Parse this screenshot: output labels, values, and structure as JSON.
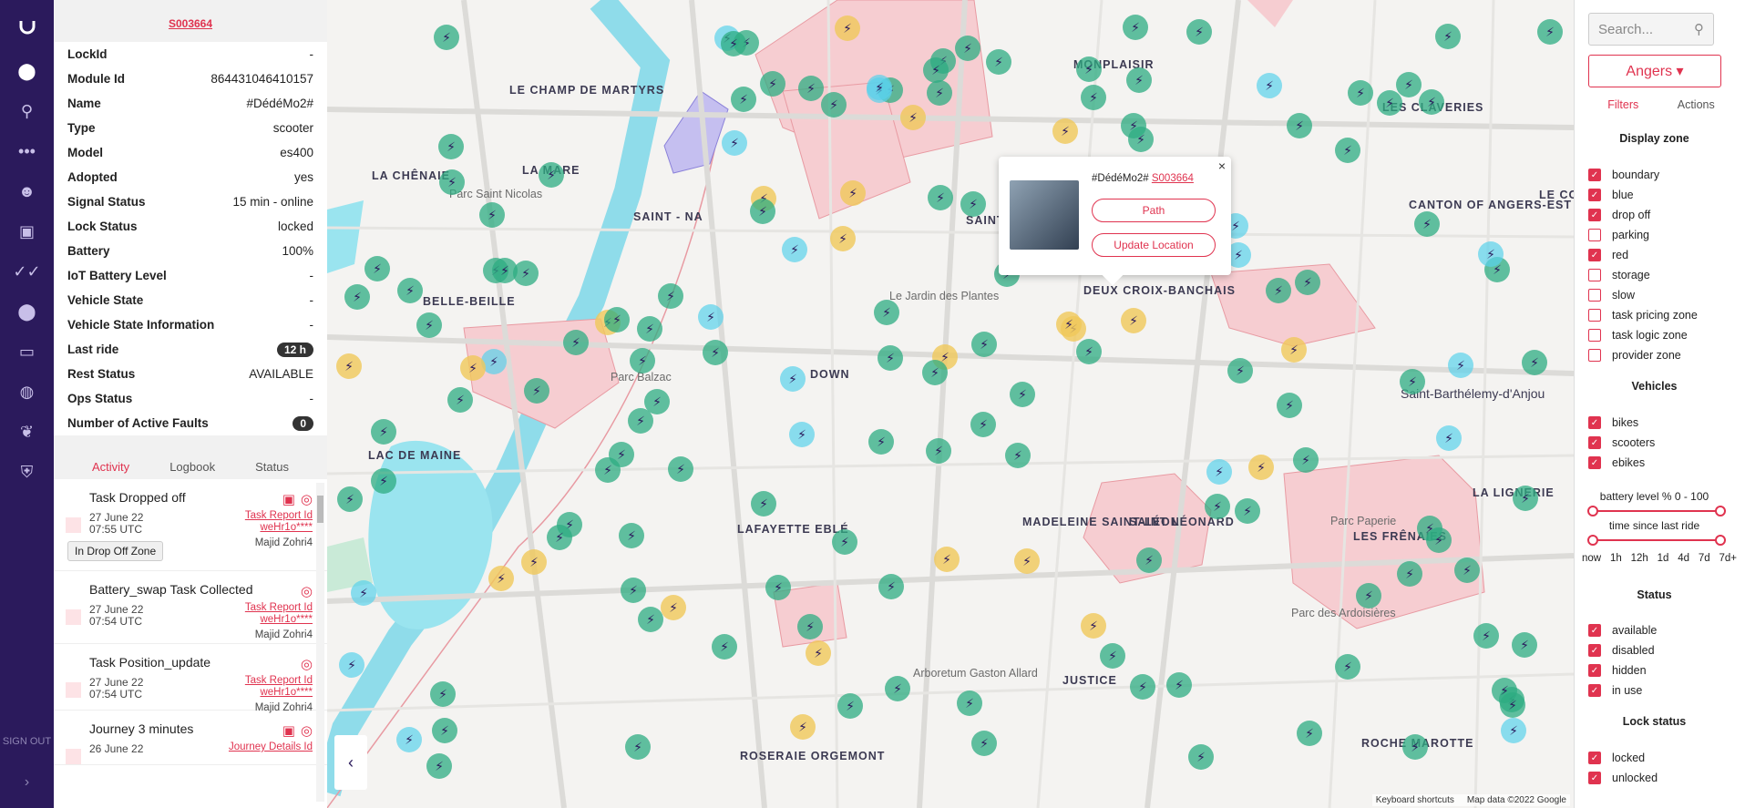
{
  "nav": {
    "signout": "SIGN OUT",
    "items": [
      "map-pin-icon",
      "bike-icon",
      "dots-icon",
      "user-icon",
      "ticket-icon",
      "check-icon",
      "location-icon",
      "card-icon",
      "globe-icon",
      "butterfly-icon",
      "shield-icon"
    ]
  },
  "vehicle": {
    "id_link": "S003664",
    "props": [
      {
        "k": "LockId",
        "v": "-"
      },
      {
        "k": "Module Id",
        "v": "864431046410157"
      },
      {
        "k": "Name",
        "v": "#DédéMo2#"
      },
      {
        "k": "Type",
        "v": "scooter"
      },
      {
        "k": "Model",
        "v": "es400"
      },
      {
        "k": "Adopted",
        "v": "yes"
      },
      {
        "k": "Signal Status",
        "v": "15 min - online"
      },
      {
        "k": "Lock Status",
        "v": "locked"
      },
      {
        "k": "Battery",
        "v": "100%"
      },
      {
        "k": "IoT Battery Level",
        "v": "-"
      },
      {
        "k": "Vehicle State",
        "v": "-"
      },
      {
        "k": "Vehicle State Information",
        "v": "-"
      },
      {
        "k": "Last ride",
        "v": "12 h"
      },
      {
        "k": "Rest Status",
        "v": "AVAILABLE"
      },
      {
        "k": "Ops Status",
        "v": "-"
      },
      {
        "k": "Number of Active Faults",
        "v": "0"
      }
    ]
  },
  "tabs": [
    "Activity",
    "Logbook",
    "Status"
  ],
  "activity": [
    {
      "title": "Task Dropped off",
      "date": "27 June 22",
      "time": "07:55 UTC",
      "link": "Task Report Id",
      "link2": "weHr1o****",
      "who": "Majid Zohri4",
      "tag": "In Drop Off Zone"
    },
    {
      "title": "Battery_swap Task Collected",
      "date": "27 June 22",
      "time": "07:54 UTC",
      "link": "Task Report Id",
      "link2": "weHr1o****",
      "who": "Majid Zohri4"
    },
    {
      "title": "Task Position_update",
      "date": "27 June 22",
      "time": "07:54 UTC",
      "link": "Task Report Id",
      "link2": "weHr1o****",
      "who": "Majid Zohri4"
    },
    {
      "title": "Journey 3 minutes",
      "date": "26 June 22",
      "time": "",
      "link": "Journey Details Id",
      "link2": "",
      "who": ""
    }
  ],
  "popup": {
    "name": "#DédéMo2#",
    "link": "S003664",
    "path_btn": "Path",
    "update_btn": "Update Location",
    "close": "×"
  },
  "map_labels": [
    "LE CHAMP DE MARTYRS",
    "LA MARE",
    "MONPLAISIR",
    "LES CLAVERIES",
    "LA CHÊNAIE",
    "Parc Saint Nicolas",
    "SAINT - NA",
    "SAINT-SERGE",
    "CANTON OF ANGERS-EST",
    "LE CO",
    "BELLE-BEILLE",
    "DEUX CROIX-BANCHAIS",
    "Parc Balzac",
    "LAC DE MAINE",
    "DOWN",
    "Saint-Barthélemy-d'Anjou",
    "LA LIGNERIE",
    "MADELEINE SAINT-LÉON",
    "SAINT LÉONARD",
    "LES FRÊNAIES",
    "Parc Paperie",
    "LAFAYETTE EBLÉ",
    "JUSTICE",
    "Parc des Ardoisières",
    "ROCHE MAROTTE",
    "ROSERAIE ORGEMONT",
    "Arboretum Gaston Allard",
    "Le Jardin des Plantes"
  ],
  "attribution": {
    "shortcuts": "Keyboard shortcuts",
    "data": "Map data ©2022 Google"
  },
  "right": {
    "search_placeholder": "Search...",
    "city": "Angers ▾",
    "tabs": [
      "Filters",
      "Actions"
    ],
    "display_zone_title": "Display zone",
    "zones": [
      {
        "label": "boundary",
        "on": true
      },
      {
        "label": "blue",
        "on": true
      },
      {
        "label": "drop off",
        "on": true
      },
      {
        "label": "parking",
        "on": false
      },
      {
        "label": "red",
        "on": true
      },
      {
        "label": "storage",
        "on": false
      },
      {
        "label": "slow",
        "on": false
      },
      {
        "label": "task pricing zone",
        "on": false
      },
      {
        "label": "task logic zone",
        "on": false
      },
      {
        "label": "provider zone",
        "on": false
      }
    ],
    "vehicles_title": "Vehicles",
    "vehicles": [
      {
        "label": "bikes",
        "on": true
      },
      {
        "label": "scooters",
        "on": true
      },
      {
        "label": "ebikes",
        "on": true
      }
    ],
    "battery_label": "battery level % 0 - 100",
    "ride_label": "time since last ride",
    "ride_ticks": [
      "now",
      "1h",
      "12h",
      "1d",
      "4d",
      "7d",
      "7d+"
    ],
    "status_title": "Status",
    "status": [
      {
        "label": "available",
        "on": true
      },
      {
        "label": "disabled",
        "on": true
      },
      {
        "label": "hidden",
        "on": true
      },
      {
        "label": "in use",
        "on": true
      }
    ],
    "lock_title": "Lock status",
    "lock": [
      {
        "label": "locked",
        "on": true
      },
      {
        "label": "unlocked",
        "on": true
      }
    ]
  },
  "colors": {
    "accent": "#e0334f",
    "nav": "#2b1a5c",
    "marker_green": "#2dac82",
    "marker_yellow": "#f0c85a",
    "marker_cyan": "#5ad2eb"
  }
}
